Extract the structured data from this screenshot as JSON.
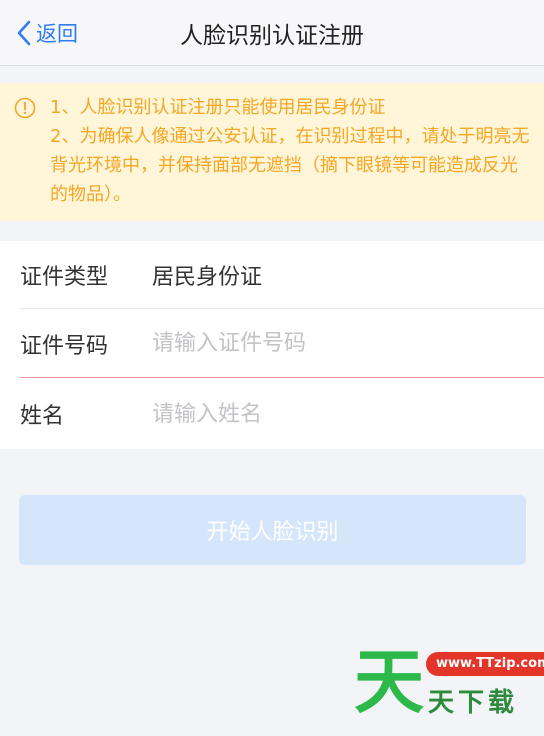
{
  "navbar": {
    "back_label": "返回",
    "title": "人脸识别认证注册"
  },
  "notice": {
    "line1": "1、人脸识别认证注册只能使用居民身份证",
    "line2": "2、为确保人像通过公安认证，在识别过程中，请处于明亮无背光环境中，并保持面部无遮挡（摘下眼镜等可能造成反光的物品）。"
  },
  "form": {
    "id_type": {
      "label": "证件类型",
      "value": "居民身份证"
    },
    "id_number": {
      "label": "证件号码",
      "value": "",
      "placeholder": "请输入证件号码"
    },
    "name": {
      "label": "姓名",
      "value": "",
      "placeholder": "请输入姓名"
    }
  },
  "submit": {
    "label": "开始人脸识别"
  },
  "watermark": {
    "big_char": "天",
    "url": "www.TTzip.com",
    "chars": "天下载"
  },
  "colors": {
    "accent": "#2f7cf6",
    "notice_text": "#f5a623",
    "notice_bg": "#fff6d9",
    "button_bg": "#d5e6fb",
    "active_underline": "#e89a9a"
  }
}
